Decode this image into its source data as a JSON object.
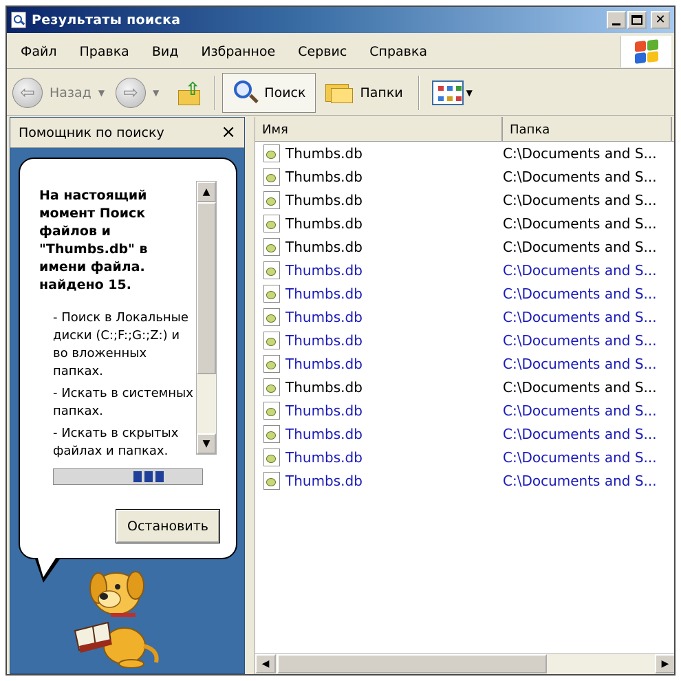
{
  "window": {
    "title": "Результаты поиска"
  },
  "menu": {
    "items": [
      "Файл",
      "Правка",
      "Вид",
      "Избранное",
      "Сервис",
      "Справка"
    ]
  },
  "toolbar": {
    "back_label": "Назад",
    "search_label": "Поиск",
    "folders_label": "Папки"
  },
  "search_pane": {
    "title": "Помощник по поиску",
    "status": "На настоящий момент Поиск файлов и \"Thumbs.db\" в имени файла. найдено 15.",
    "options": [
      "- Поиск в Локальные диски (C:;F:;G:;Z:) и во вложенных папках.",
      "- Искать в системных папках.",
      "- Искать в скрытых файлах и папках."
    ],
    "stop_label": "Остановить"
  },
  "results": {
    "columns": [
      "Имя",
      "Папка"
    ],
    "rows": [
      {
        "name": "Thumbs.db",
        "folder": "C:\\Documents and S...",
        "selected": false
      },
      {
        "name": "Thumbs.db",
        "folder": "C:\\Documents and S...",
        "selected": false
      },
      {
        "name": "Thumbs.db",
        "folder": "C:\\Documents and S...",
        "selected": false
      },
      {
        "name": "Thumbs.db",
        "folder": "C:\\Documents and S...",
        "selected": false
      },
      {
        "name": "Thumbs.db",
        "folder": "C:\\Documents and S...",
        "selected": false
      },
      {
        "name": "Thumbs.db",
        "folder": "C:\\Documents and S...",
        "selected": true
      },
      {
        "name": "Thumbs.db",
        "folder": "C:\\Documents and S...",
        "selected": true
      },
      {
        "name": "Thumbs.db",
        "folder": "C:\\Documents and S...",
        "selected": true
      },
      {
        "name": "Thumbs.db",
        "folder": "C:\\Documents and S...",
        "selected": true
      },
      {
        "name": "Thumbs.db",
        "folder": "C:\\Documents and S...",
        "selected": true
      },
      {
        "name": "Thumbs.db",
        "folder": "C:\\Documents and S...",
        "selected": false
      },
      {
        "name": "Thumbs.db",
        "folder": "C:\\Documents and S...",
        "selected": true
      },
      {
        "name": "Thumbs.db",
        "folder": "C:\\Documents and S...",
        "selected": true
      },
      {
        "name": "Thumbs.db",
        "folder": "C:\\Documents and S...",
        "selected": true
      },
      {
        "name": "Thumbs.db",
        "folder": "C:\\Documents and S...",
        "selected": true
      }
    ]
  },
  "icons": {
    "title": "search-icon",
    "back": "back-arrow-icon",
    "forward": "forward-arrow-icon",
    "up": "folder-up-icon",
    "search": "magnifier-icon",
    "folders": "folders-icon",
    "views": "views-icon",
    "file": "thumbs-file-icon",
    "logo": "windows-logo-icon",
    "assistant": "dog-assistant-icon"
  },
  "colors": {
    "titlebar_start": "#0a246a",
    "titlebar_end": "#a6caf0",
    "pane_background": "#3a6ea5",
    "selected_text": "#1a1ab8",
    "progress": "#1f3f9a"
  }
}
